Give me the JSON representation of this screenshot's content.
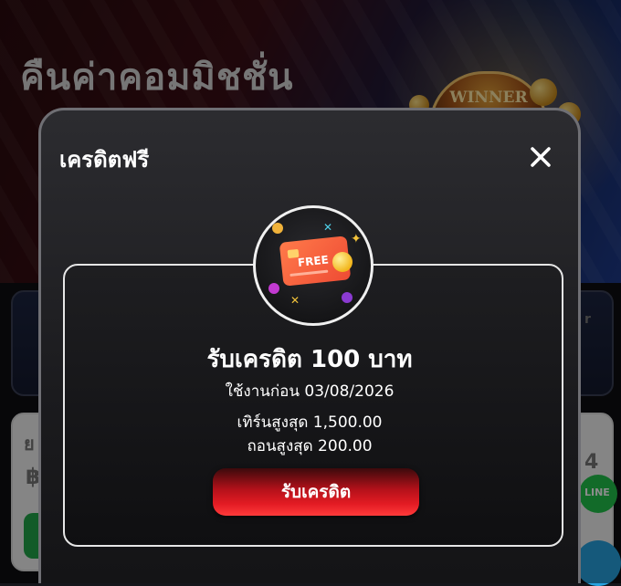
{
  "background": {
    "banner_title": "คืนค่าคอมมิชชั่น",
    "winner_sign": "WINNER",
    "line_button": "LINE",
    "currency_symbol": "฿",
    "partial_text_left": "ย",
    "partial_text_right": "r",
    "partial_number_right": "4"
  },
  "modal": {
    "title": "เครดิตฟรี",
    "close_icon": "close-icon",
    "badge": {
      "icon": "free-credit-card-icon",
      "card_text": "FREE"
    },
    "credit_amount": "รับเครดิต 100 บาท",
    "expiry": "ใช้งานก่อน 03/08/2026",
    "max_turnover": "เทิร์นสูงสุด 1,500.00",
    "max_withdraw": "ถอนสูงสุด 200.00",
    "claim_button": "รับเครดิต"
  },
  "colors": {
    "accent_red": "#e31b23",
    "modal_border": "#6f6f74",
    "card_border": "#e6e6e6"
  }
}
